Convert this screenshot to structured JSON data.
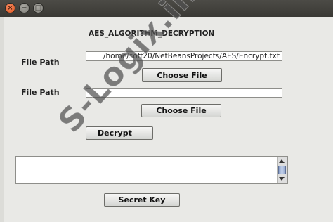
{
  "window": {
    "close_glyph": "×",
    "minimize_glyph": "−",
    "maximize_glyph": "□"
  },
  "heading": "AES_ALGORITHM_DECRYPTION",
  "row1": {
    "label": "File Path",
    "value": "/home/soft20/NetBeansProjects/AES/Encrypt.txt",
    "button": "Choose File"
  },
  "row2": {
    "label": "File Path",
    "value": "",
    "button": "Choose File"
  },
  "decrypt_button": "Decrypt",
  "output_text": "",
  "secret_key_button": "Secret Key",
  "watermark": "S-Logix.in",
  "icons": {
    "scroll_up": "triangle-up",
    "scroll_down": "triangle-down"
  }
}
